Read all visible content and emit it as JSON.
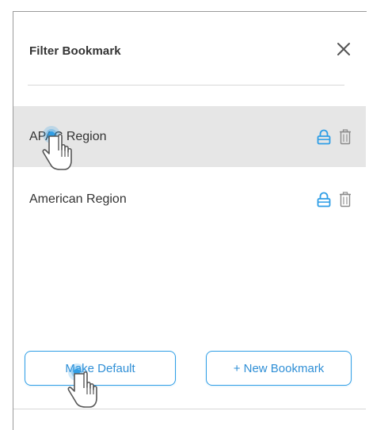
{
  "panel": {
    "title": "Filter Bookmark",
    "close_icon": "close-icon"
  },
  "bookmarks": [
    {
      "label": "APAC Region",
      "selected": true,
      "lock_icon": "lock-icon",
      "delete_icon": "trash-icon"
    },
    {
      "label": "American Region",
      "selected": false,
      "lock_icon": "lock-icon",
      "delete_icon": "trash-icon"
    }
  ],
  "actions": {
    "make_default_label": "Make Default",
    "new_bookmark_label": "+ New Bookmark"
  },
  "colors": {
    "accent": "#2f9ee6",
    "selected_row": "#e6e6e6",
    "divider": "#d8d8d8",
    "text": "#333333",
    "icon_gray": "#8a8a8a"
  }
}
